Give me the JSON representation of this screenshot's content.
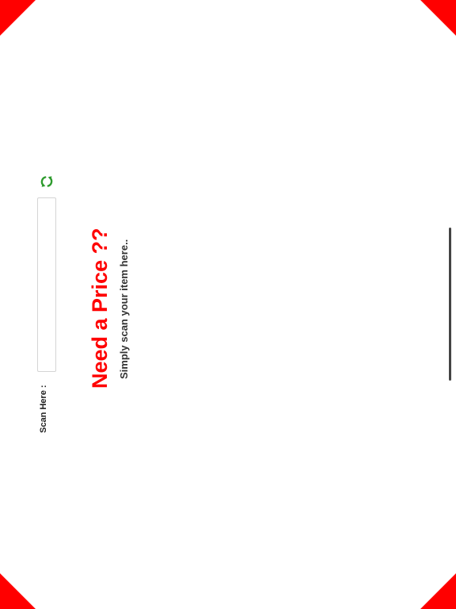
{
  "scan": {
    "label": "Scan Here :",
    "value": "",
    "placeholder": ""
  },
  "icons": {
    "refresh": "refresh-icon"
  },
  "hero": {
    "heading": "Need a Price ??",
    "subheading": "Simply scan your item here.."
  },
  "colors": {
    "accent": "#ff0000",
    "icon": "#2e9b2e",
    "text": "#222222"
  }
}
